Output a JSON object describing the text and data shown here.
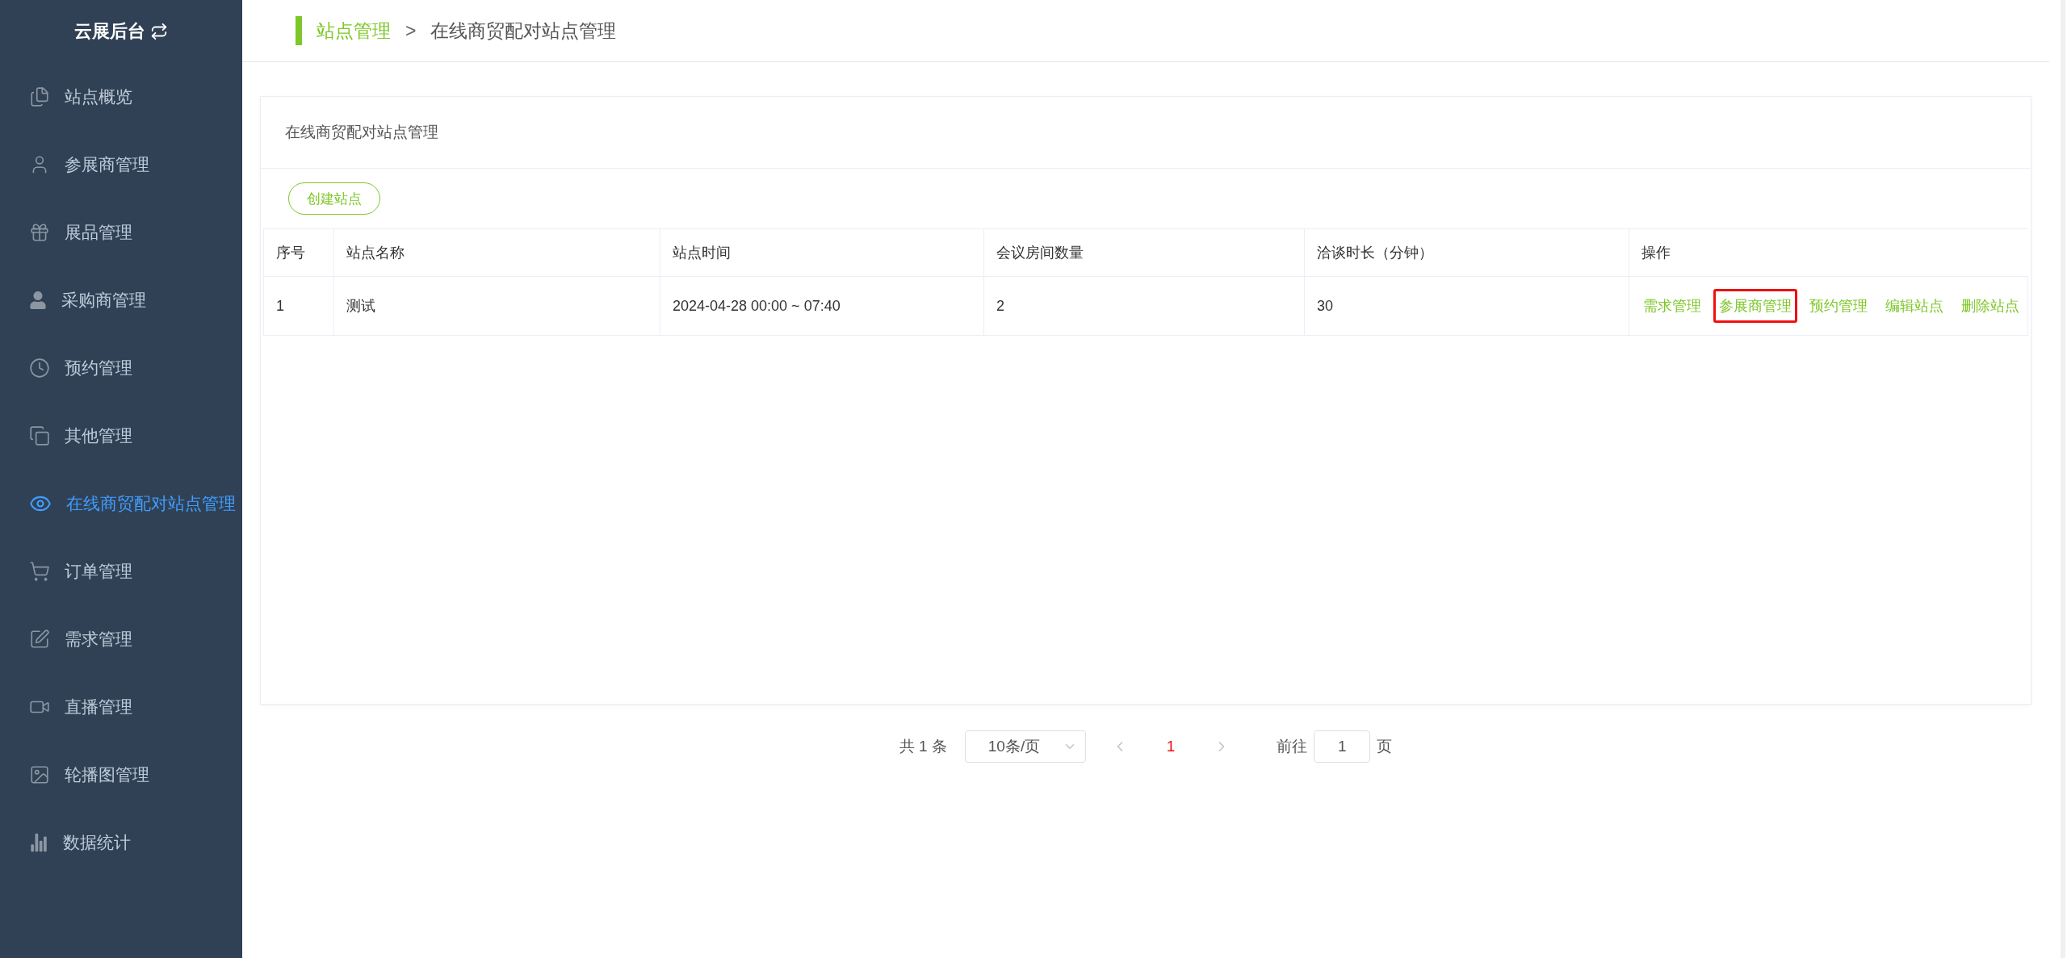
{
  "sidebar": {
    "title": "云展后台",
    "items": [
      {
        "label": "站点概览",
        "selected": false
      },
      {
        "label": "参展商管理",
        "selected": false
      },
      {
        "label": "展品管理",
        "selected": false
      },
      {
        "label": "采购商管理",
        "selected": false
      },
      {
        "label": "预约管理",
        "selected": false
      },
      {
        "label": "其他管理",
        "selected": false
      },
      {
        "label": "在线商贸配对站点管理",
        "selected": true
      },
      {
        "label": "订单管理",
        "selected": false
      },
      {
        "label": "需求管理",
        "selected": false
      },
      {
        "label": "直播管理",
        "selected": false
      },
      {
        "label": "轮播图管理",
        "selected": false
      },
      {
        "label": "数据统计",
        "selected": false
      }
    ]
  },
  "breadcrumb": {
    "parent": "站点管理",
    "separator": ">",
    "current": "在线商贸配对站点管理"
  },
  "card": {
    "title": "在线商贸配对站点管理",
    "create_button": "创建站点",
    "table": {
      "columns": [
        "序号",
        "站点名称",
        "站点时间",
        "会议房间数量",
        "洽谈时长（分钟）",
        "操作"
      ],
      "rows": [
        {
          "cells": [
            "1",
            "测试",
            "2024-04-28 00:00 ~ 07:40",
            "2",
            "30"
          ],
          "actions": [
            {
              "label": "需求管理",
              "highlighted": false
            },
            {
              "label": "参展商管理",
              "highlighted": true
            },
            {
              "label": "预约管理",
              "highlighted": false
            },
            {
              "label": "编辑站点",
              "highlighted": false
            },
            {
              "label": "删除站点",
              "highlighted": false
            }
          ]
        }
      ]
    }
  },
  "pagination": {
    "total": "共 1 条",
    "page_size": "10条/页",
    "current_page": "1",
    "goto_label": "前往",
    "goto_value": "1",
    "page_suffix": "页"
  }
}
